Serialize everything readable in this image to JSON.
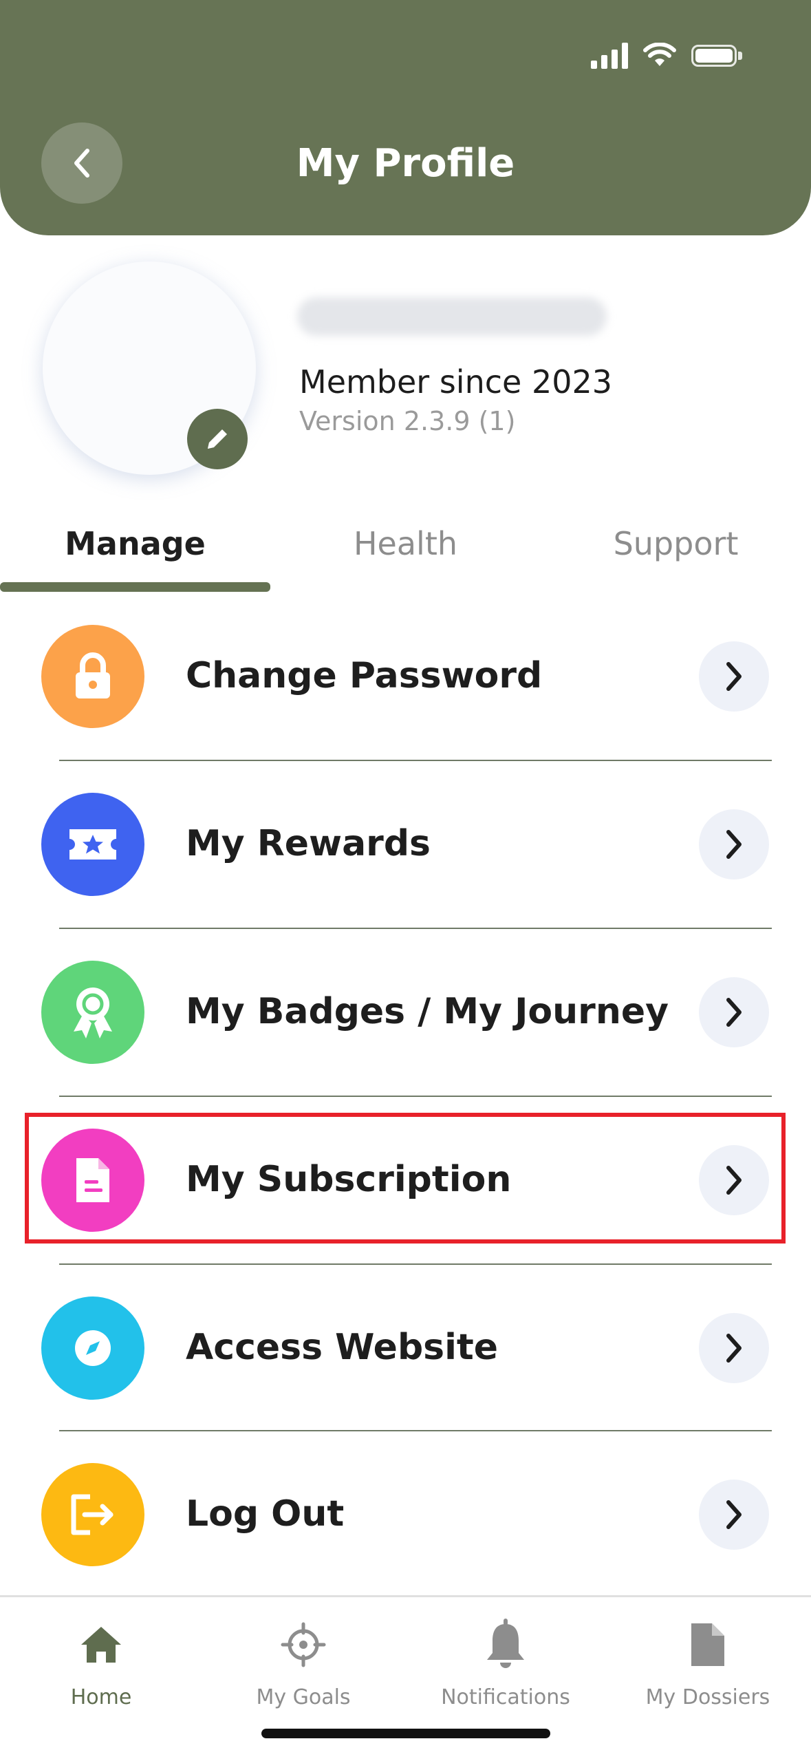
{
  "header": {
    "title": "My Profile"
  },
  "profile": {
    "member_since": "Member since 2023",
    "version": "Version 2.3.9 (1)"
  },
  "tabs": [
    {
      "label": "Manage",
      "active": true
    },
    {
      "label": "Health",
      "active": false
    },
    {
      "label": "Support",
      "active": false
    }
  ],
  "menu": [
    {
      "label": "Change Password",
      "icon": "lock-icon",
      "color": "#FCA24A"
    },
    {
      "label": "My Rewards",
      "icon": "ticket-star-icon",
      "color": "#3F63F0"
    },
    {
      "label": "My Badges / My Journey",
      "icon": "award-icon",
      "color": "#5FD57A"
    },
    {
      "label": "My Subscription",
      "icon": "document-icon",
      "color": "#F23EC1",
      "highlighted": true
    },
    {
      "label": "Access Website",
      "icon": "compass-icon",
      "color": "#22C1EA"
    },
    {
      "label": "Log Out",
      "icon": "logout-icon",
      "color": "#FDB912"
    }
  ],
  "bottom_nav": [
    {
      "label": "Home",
      "icon": "home-icon",
      "active": true
    },
    {
      "label": "My Goals",
      "icon": "target-icon",
      "active": false
    },
    {
      "label": "Notifications",
      "icon": "bell-icon",
      "active": false
    },
    {
      "label": "My Dossiers",
      "icon": "file-icon",
      "active": false
    }
  ],
  "colors": {
    "header_bg": "#677455",
    "accent": "#5F6D4F",
    "highlight": "#E8212A"
  }
}
